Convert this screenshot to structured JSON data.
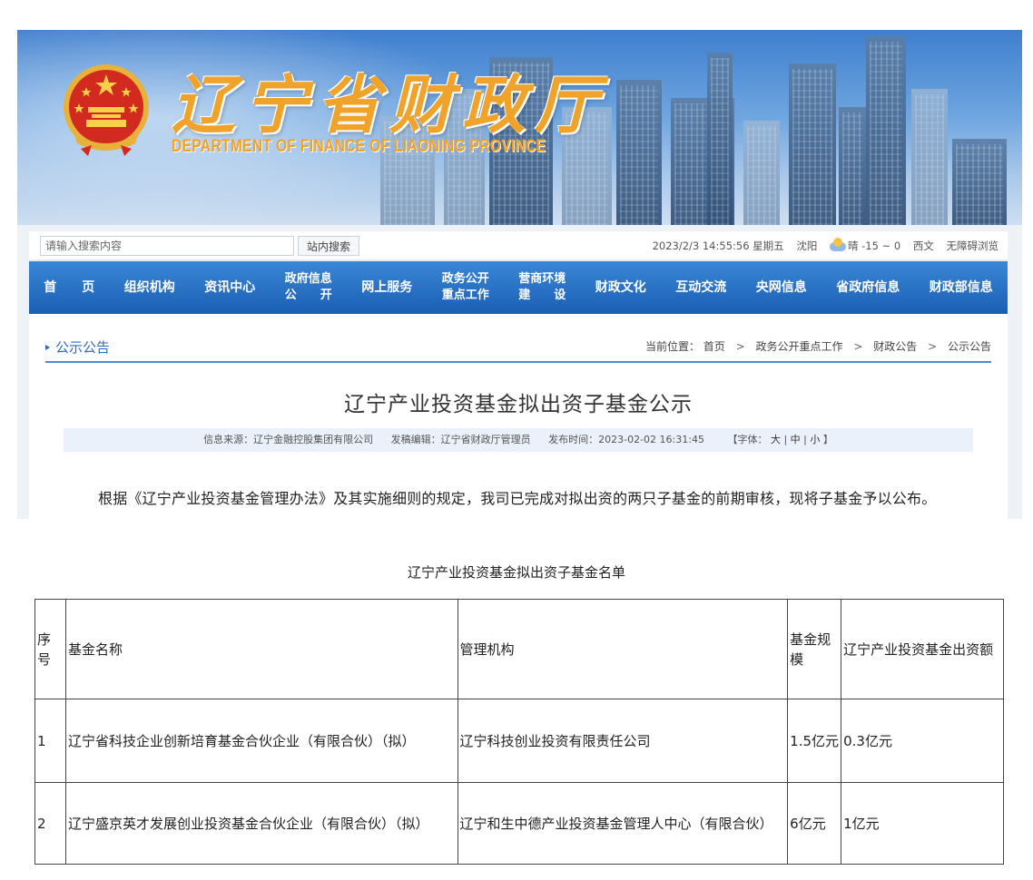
{
  "header": {
    "site_title": "辽宁省财政厅",
    "site_subtitle": "DEPARTMENT OF FINANCE OF LIAONING PROVINCE"
  },
  "search": {
    "placeholder": "请输入搜索内容",
    "button_label": "站内搜索"
  },
  "status": {
    "datetime": "2023/2/3 14:55:56 星期五",
    "city": "沈阳",
    "weather": "晴 -15 ~ 0",
    "traditional": "西文",
    "accessibility": "无障碍浏览"
  },
  "nav": {
    "items": [
      {
        "label": "首　　页"
      },
      {
        "label": "组织机构"
      },
      {
        "label": "资讯中心"
      },
      {
        "line1": "政府信息",
        "line2": "公　　开"
      },
      {
        "label": "网上服务"
      },
      {
        "line1": "政务公开",
        "line2": "重点工作"
      },
      {
        "line1": "营商环境",
        "line2": "建　　设"
      },
      {
        "label": "财政文化"
      },
      {
        "label": "互动交流"
      },
      {
        "label": "央网信息"
      },
      {
        "label": "省政府信息"
      },
      {
        "label": "财政部信息"
      }
    ]
  },
  "content": {
    "section_label": "公示公告",
    "breadcrumb": {
      "prefix": "当前位置：",
      "items": [
        "首页",
        "政务公开重点工作",
        "财政公告",
        "公示公告"
      ]
    },
    "article_title": "辽宁产业投资基金拟出资子基金公示",
    "meta": {
      "source": "信息来源：辽宁金融控股集团有限公司",
      "editor": "发稿编辑：辽宁省财政厅管理员",
      "published": "发布时间：2023-02-02 16:31:45",
      "font_label": "【字体：",
      "font_large": "大",
      "font_medium": "中",
      "font_small": "小",
      "font_end": "】"
    },
    "intro": "根据《辽宁产业投资基金管理办法》及其实施细则的规定，我司已完成对拟出资的两只子基金的前期审核，现将子基金予以公布。"
  },
  "fund_list": {
    "title": "辽宁产业投资基金拟出资子基金名单",
    "headers": {
      "index": "序号",
      "name": "基金名称",
      "manager": "管理机构",
      "scale": "基金规模",
      "amount": "辽宁产业投资基金出资额"
    },
    "rows": [
      {
        "index": "1",
        "name": "辽宁省科技企业创新培育基金合伙企业（有限合伙）（拟）",
        "manager": "辽宁科技创业投资有限责任公司",
        "scale": "1.5亿元",
        "amount": "0.3亿元"
      },
      {
        "index": "2",
        "name": "辽宁盛京英才发展创业投资基金合伙企业（有限合伙）（拟）",
        "manager": "辽宁和生中德产业投资基金管理人中心（有限合伙）",
        "scale": "6亿元",
        "amount": "1亿元"
      }
    ]
  },
  "colors": {
    "nav_blue": "#1a5fb4",
    "title_orange": "#f0a32a",
    "accent_blue": "#2a6cc0"
  }
}
